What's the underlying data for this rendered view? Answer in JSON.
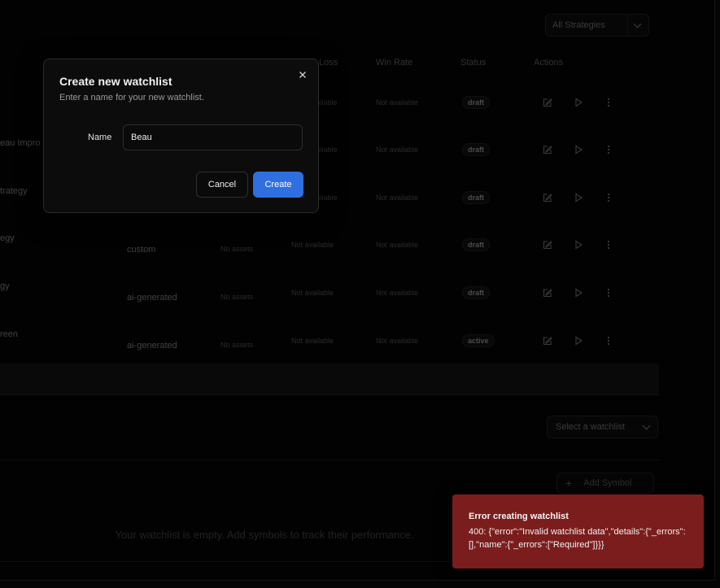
{
  "filters": {
    "strategy_filter": "All Strategies",
    "watchlist_select": "Select a watchlist"
  },
  "table": {
    "headers": {
      "loss": "Loss",
      "win_rate": "Win Rate",
      "status": "Status",
      "actions": "Actions"
    },
    "rows": [
      {
        "name": "",
        "type": "",
        "assets": "",
        "loss": "available",
        "win_rate": "Not available",
        "status": "draft"
      },
      {
        "name": "eau Impro",
        "type": "",
        "assets": "",
        "loss": "available",
        "win_rate": "Not available",
        "status": "draft"
      },
      {
        "name": "trategy",
        "type": "",
        "assets": "",
        "loss": "available",
        "win_rate": "Not available",
        "status": "draft"
      },
      {
        "name": "egy",
        "type": "custom",
        "assets": "No assets",
        "loss": "Not available",
        "win_rate": "Not available",
        "status": "draft"
      },
      {
        "name": "gy",
        "type": "ai-generated",
        "assets": "No assets",
        "loss": "Not available",
        "win_rate": "Not available",
        "status": "draft"
      },
      {
        "name": "reen",
        "type": "ai-generated",
        "assets": "No assets",
        "loss": "Not available",
        "win_rate": "Not available",
        "status": "active"
      }
    ]
  },
  "watchlist": {
    "add_symbol_label": "Add Symbol",
    "empty_message": "Your watchlist is empty. Add symbols to track their performance."
  },
  "modal": {
    "title": "Create new watchlist",
    "description": "Enter a name for your new watchlist.",
    "name_label": "Name",
    "name_value": "Beau",
    "cancel_label": "Cancel",
    "create_label": "Create"
  },
  "toast": {
    "title": "Error creating watchlist",
    "message": "400: {\"error\":\"Invalid watchlist data\",\"details\":{\"_errors\":[],\"name\":{\"_errors\":[\"Required\"]}}}",
    "color": "#7b1d1d"
  },
  "colors": {
    "primary": "#2f6fe0",
    "background": "#0a0a0a"
  }
}
